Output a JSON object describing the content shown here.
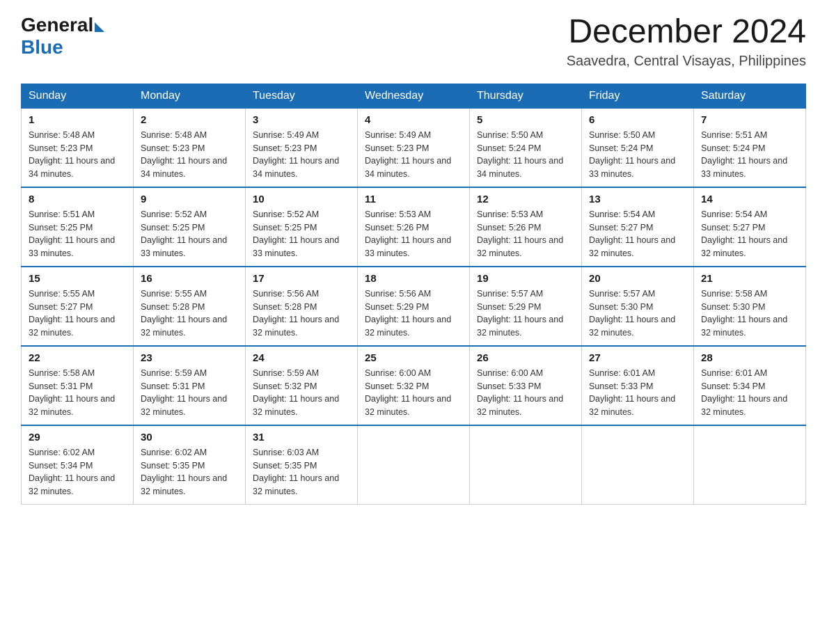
{
  "logo": {
    "general": "General",
    "blue": "Blue"
  },
  "header": {
    "month_year": "December 2024",
    "location": "Saavedra, Central Visayas, Philippines"
  },
  "days_of_week": [
    "Sunday",
    "Monday",
    "Tuesday",
    "Wednesday",
    "Thursday",
    "Friday",
    "Saturday"
  ],
  "weeks": [
    [
      {
        "day": "1",
        "sunrise": "5:48 AM",
        "sunset": "5:23 PM",
        "daylight": "11 hours and 34 minutes."
      },
      {
        "day": "2",
        "sunrise": "5:48 AM",
        "sunset": "5:23 PM",
        "daylight": "11 hours and 34 minutes."
      },
      {
        "day": "3",
        "sunrise": "5:49 AM",
        "sunset": "5:23 PM",
        "daylight": "11 hours and 34 minutes."
      },
      {
        "day": "4",
        "sunrise": "5:49 AM",
        "sunset": "5:23 PM",
        "daylight": "11 hours and 34 minutes."
      },
      {
        "day": "5",
        "sunrise": "5:50 AM",
        "sunset": "5:24 PM",
        "daylight": "11 hours and 34 minutes."
      },
      {
        "day": "6",
        "sunrise": "5:50 AM",
        "sunset": "5:24 PM",
        "daylight": "11 hours and 33 minutes."
      },
      {
        "day": "7",
        "sunrise": "5:51 AM",
        "sunset": "5:24 PM",
        "daylight": "11 hours and 33 minutes."
      }
    ],
    [
      {
        "day": "8",
        "sunrise": "5:51 AM",
        "sunset": "5:25 PM",
        "daylight": "11 hours and 33 minutes."
      },
      {
        "day": "9",
        "sunrise": "5:52 AM",
        "sunset": "5:25 PM",
        "daylight": "11 hours and 33 minutes."
      },
      {
        "day": "10",
        "sunrise": "5:52 AM",
        "sunset": "5:25 PM",
        "daylight": "11 hours and 33 minutes."
      },
      {
        "day": "11",
        "sunrise": "5:53 AM",
        "sunset": "5:26 PM",
        "daylight": "11 hours and 33 minutes."
      },
      {
        "day": "12",
        "sunrise": "5:53 AM",
        "sunset": "5:26 PM",
        "daylight": "11 hours and 32 minutes."
      },
      {
        "day": "13",
        "sunrise": "5:54 AM",
        "sunset": "5:27 PM",
        "daylight": "11 hours and 32 minutes."
      },
      {
        "day": "14",
        "sunrise": "5:54 AM",
        "sunset": "5:27 PM",
        "daylight": "11 hours and 32 minutes."
      }
    ],
    [
      {
        "day": "15",
        "sunrise": "5:55 AM",
        "sunset": "5:27 PM",
        "daylight": "11 hours and 32 minutes."
      },
      {
        "day": "16",
        "sunrise": "5:55 AM",
        "sunset": "5:28 PM",
        "daylight": "11 hours and 32 minutes."
      },
      {
        "day": "17",
        "sunrise": "5:56 AM",
        "sunset": "5:28 PM",
        "daylight": "11 hours and 32 minutes."
      },
      {
        "day": "18",
        "sunrise": "5:56 AM",
        "sunset": "5:29 PM",
        "daylight": "11 hours and 32 minutes."
      },
      {
        "day": "19",
        "sunrise": "5:57 AM",
        "sunset": "5:29 PM",
        "daylight": "11 hours and 32 minutes."
      },
      {
        "day": "20",
        "sunrise": "5:57 AM",
        "sunset": "5:30 PM",
        "daylight": "11 hours and 32 minutes."
      },
      {
        "day": "21",
        "sunrise": "5:58 AM",
        "sunset": "5:30 PM",
        "daylight": "11 hours and 32 minutes."
      }
    ],
    [
      {
        "day": "22",
        "sunrise": "5:58 AM",
        "sunset": "5:31 PM",
        "daylight": "11 hours and 32 minutes."
      },
      {
        "day": "23",
        "sunrise": "5:59 AM",
        "sunset": "5:31 PM",
        "daylight": "11 hours and 32 minutes."
      },
      {
        "day": "24",
        "sunrise": "5:59 AM",
        "sunset": "5:32 PM",
        "daylight": "11 hours and 32 minutes."
      },
      {
        "day": "25",
        "sunrise": "6:00 AM",
        "sunset": "5:32 PM",
        "daylight": "11 hours and 32 minutes."
      },
      {
        "day": "26",
        "sunrise": "6:00 AM",
        "sunset": "5:33 PM",
        "daylight": "11 hours and 32 minutes."
      },
      {
        "day": "27",
        "sunrise": "6:01 AM",
        "sunset": "5:33 PM",
        "daylight": "11 hours and 32 minutes."
      },
      {
        "day": "28",
        "sunrise": "6:01 AM",
        "sunset": "5:34 PM",
        "daylight": "11 hours and 32 minutes."
      }
    ],
    [
      {
        "day": "29",
        "sunrise": "6:02 AM",
        "sunset": "5:34 PM",
        "daylight": "11 hours and 32 minutes."
      },
      {
        "day": "30",
        "sunrise": "6:02 AM",
        "sunset": "5:35 PM",
        "daylight": "11 hours and 32 minutes."
      },
      {
        "day": "31",
        "sunrise": "6:03 AM",
        "sunset": "5:35 PM",
        "daylight": "11 hours and 32 minutes."
      },
      null,
      null,
      null,
      null
    ]
  ],
  "labels": {
    "sunrise_prefix": "Sunrise: ",
    "sunset_prefix": "Sunset: ",
    "daylight_prefix": "Daylight: "
  }
}
